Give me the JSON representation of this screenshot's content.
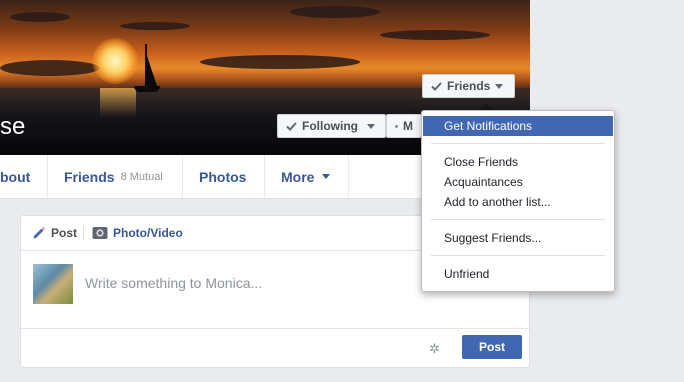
{
  "profile": {
    "name_fragment": "se"
  },
  "cover_buttons": {
    "friends_label": "Friends",
    "following_label": "Following",
    "message_label": "M"
  },
  "nav": {
    "about_label": "bout",
    "friends_label": "Friends",
    "friends_mutual": "8 Mutual",
    "photos_label": "Photos",
    "more_label": "More"
  },
  "composer": {
    "tab_post": "Post",
    "tab_photo_video": "Photo/Video",
    "placeholder": "Write something to Monica...",
    "post_button": "Post"
  },
  "friends_menu": {
    "items": [
      "Get Notifications",
      "Close Friends",
      "Acquaintances",
      "Add to another list...",
      "Suggest Friends...",
      "Unfriend"
    ],
    "active_index": 0
  },
  "colors": {
    "accent": "#4267b2",
    "link": "#365899",
    "page_bg": "#e9ebee"
  }
}
